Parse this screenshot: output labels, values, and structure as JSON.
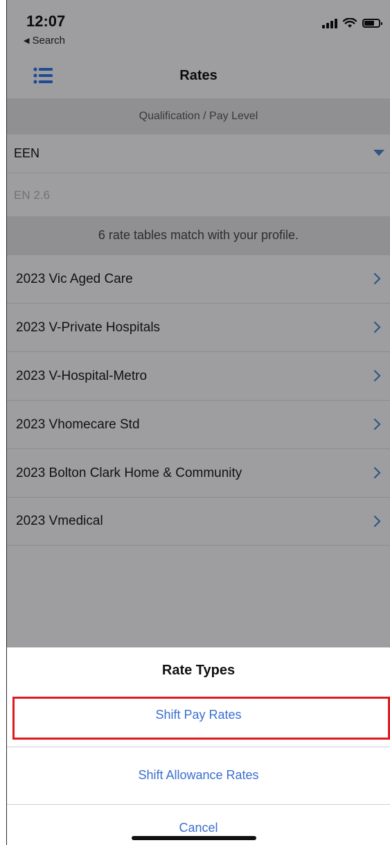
{
  "status_bar": {
    "time": "12:07",
    "back_label": "Search"
  },
  "navbar": {
    "title": "Rates",
    "menu_icon": "list-icon"
  },
  "qualification": {
    "header": "Qualification / Pay Level",
    "selected_qualification": "EEN",
    "pay_level": "EN 2.6"
  },
  "rate_tables": {
    "header": "6 rate tables match with your profile.",
    "items": [
      {
        "label": "2023 Vic Aged Care"
      },
      {
        "label": "2023 V-Private Hospitals"
      },
      {
        "label": "2023 V-Hospital-Metro"
      },
      {
        "label": "2023 Vhomecare Std"
      },
      {
        "label": "2023 Bolton Clark Home & Community"
      },
      {
        "label": "2023 Vmedical"
      }
    ]
  },
  "action_sheet": {
    "title": "Rate Types",
    "options": [
      {
        "label": "Shift Pay Rates",
        "highlighted": true
      },
      {
        "label": "Shift Allowance Rates"
      }
    ],
    "cancel_label": "Cancel"
  },
  "colors": {
    "accent": "#3a6fd0",
    "dropdown": "#4a7fbf",
    "highlight_border": "#e0191f"
  }
}
